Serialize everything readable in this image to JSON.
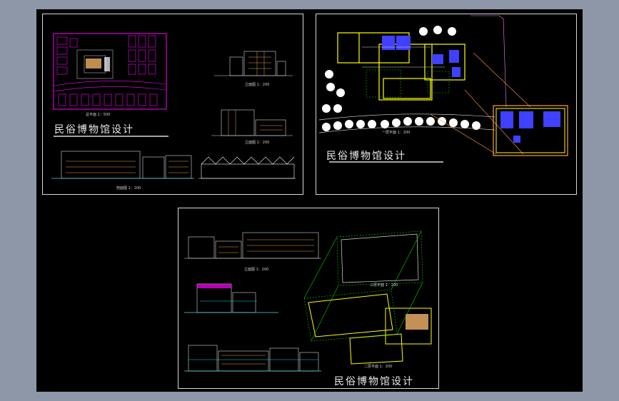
{
  "window": {
    "background": "#8d97a8",
    "canvas_background": "#000000"
  },
  "sheets": [
    {
      "title": "民俗博物馆设计",
      "labels": {
        "site_plan": "总平面 1：500",
        "elev_a": "立面图 1：200",
        "elev_b": "立面图 1：200",
        "elev_long": "剖面图 1：200"
      }
    },
    {
      "title": "民俗博物馆设计",
      "labels": {
        "plan": "一层平面 1：200"
      }
    },
    {
      "title": "民俗博物馆设计",
      "labels": {
        "elev": "立面图 1：200",
        "plan_upper": "三层平面 1：200",
        "plan_lower": "二层平面 1：200"
      }
    }
  ],
  "colors": {
    "magenta": "#ff00ff",
    "yellow": "#ffff00",
    "orange": "#ffa040",
    "cyan": "#00e0e0",
    "blue": "#4040ff",
    "green": "#00d000",
    "white": "#ffffff",
    "line": "#d8d8d8"
  }
}
